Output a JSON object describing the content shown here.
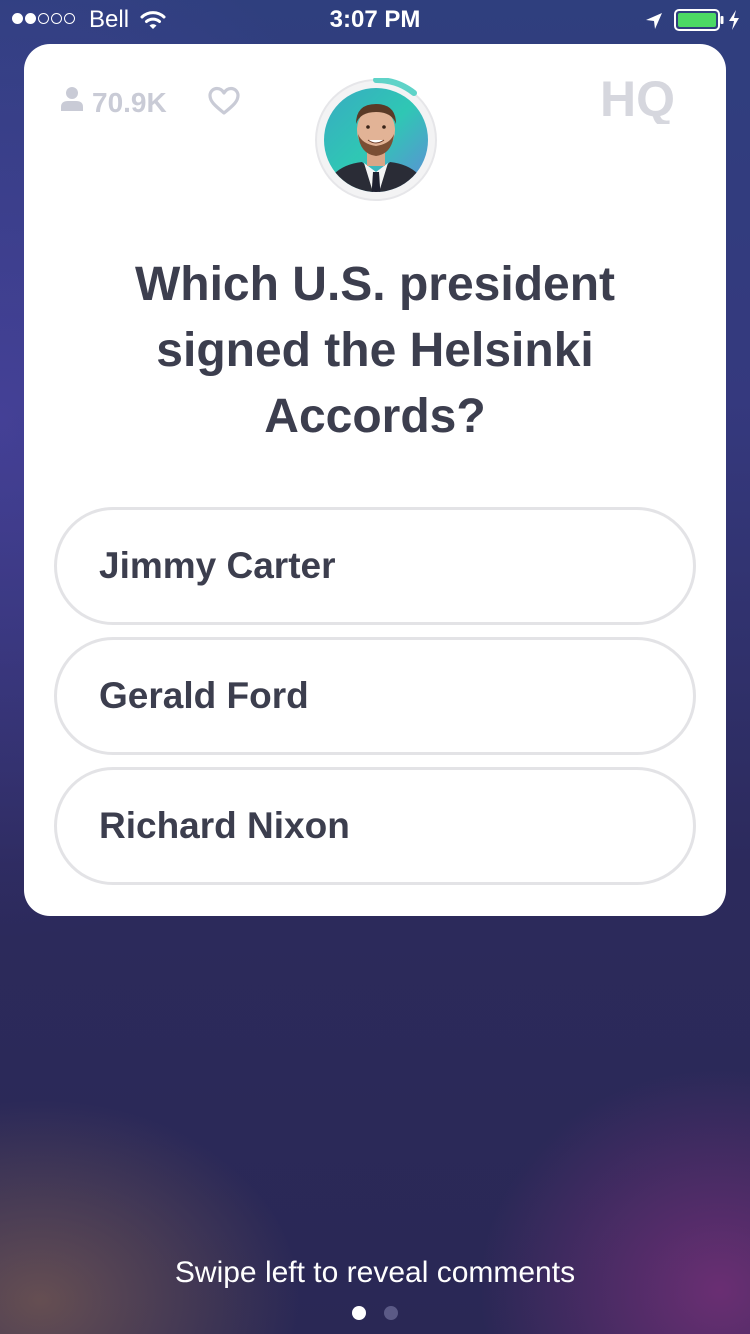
{
  "status_bar": {
    "carrier": "Bell",
    "time": "3:07 PM",
    "signal_bars_filled": 2,
    "signal_bars_total": 5,
    "battery_color": "#4cd964"
  },
  "card": {
    "viewer_count": "70.9K",
    "logo_text": "HQ",
    "question": "Which U.S. president signed the Helsinki Accords?",
    "answers": [
      {
        "label": "Jimmy Carter"
      },
      {
        "label": "Gerald Ford"
      },
      {
        "label": "Richard Nixon"
      }
    ],
    "accent_color": "#5fd3c8",
    "icons": {
      "viewers": "person-icon",
      "like": "heart-icon",
      "host": "host-avatar"
    }
  },
  "footer": {
    "hint": "Swipe left to reveal comments",
    "pages_total": 2,
    "page_active": 1
  }
}
